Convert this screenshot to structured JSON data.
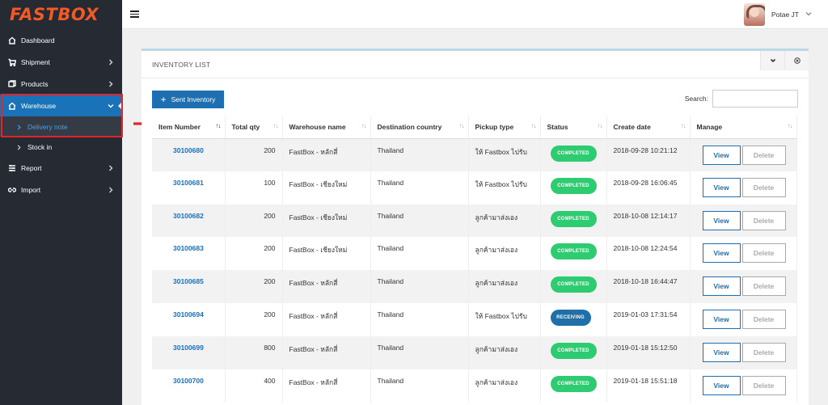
{
  "sidebar": {
    "logo": "FASTBOX",
    "items": [
      {
        "label": "Dashboard",
        "icon": "home-icon",
        "chevron": false
      },
      {
        "label": "Shipment",
        "icon": "cart-icon",
        "chevron": true
      },
      {
        "label": "Products",
        "icon": "products-icon",
        "chevron": true
      },
      {
        "label": "Warehouse",
        "icon": "home-icon",
        "chevron": true,
        "active": true
      },
      {
        "label": "Report",
        "icon": "report-icon",
        "chevron": true
      },
      {
        "label": "Import",
        "icon": "link-icon",
        "chevron": true
      }
    ],
    "sub_items": [
      {
        "label": "Delivery note",
        "active": true
      },
      {
        "label": "Stock in",
        "active": false
      }
    ]
  },
  "topbar": {
    "user_name": "Potae JT"
  },
  "panel": {
    "title": "INVENTORY LIST",
    "sent_button": "Sent Inventory",
    "search_label": "Search:",
    "search_value": ""
  },
  "table": {
    "columns": [
      "Item Number",
      "Total qty",
      "Warehouse name",
      "Destination country",
      "Pickup type",
      "Status",
      "Create date",
      "Manage"
    ],
    "view_label": "View",
    "delete_label": "Delete",
    "rows": [
      {
        "item": "30100680",
        "qty": "200",
        "warehouse": "FastBox - หลักสี่",
        "country": "Thailand",
        "pickup": "ให้ Fastbox ไปรับ",
        "status": "COMPLETED",
        "status_type": "completed",
        "date": "2018-09-28 10:21:12"
      },
      {
        "item": "30100681",
        "qty": "100",
        "warehouse": "FastBox - เชียงใหม่",
        "country": "Thailand",
        "pickup": "ให้ Fastbox ไปรับ",
        "status": "COMPLETED",
        "status_type": "completed",
        "date": "2018-09-28 16:06:45"
      },
      {
        "item": "30100682",
        "qty": "200",
        "warehouse": "FastBox - เชียงใหม่",
        "country": "Thailand",
        "pickup": "ลูกค้ามาส่งเอง",
        "status": "COMPLETED",
        "status_type": "completed",
        "date": "2018-10-08 12:14:17"
      },
      {
        "item": "30100683",
        "qty": "200",
        "warehouse": "FastBox - เชียงใหม่",
        "country": "Thailand",
        "pickup": "ลูกค้ามาส่งเอง",
        "status": "COMPLETED",
        "status_type": "completed",
        "date": "2018-10-08 12:24:54"
      },
      {
        "item": "30100685",
        "qty": "200",
        "warehouse": "FastBox - หลักสี่",
        "country": "Thailand",
        "pickup": "ลูกค้ามาส่งเอง",
        "status": "COMPLETED",
        "status_type": "completed",
        "date": "2018-10-18 16:44:47"
      },
      {
        "item": "30100694",
        "qty": "200",
        "warehouse": "FastBox - หลักสี่",
        "country": "Thailand",
        "pickup": "ให้ Fastbox ไปรับ",
        "status": "RECEIVING",
        "status_type": "receiving",
        "date": "2019-01-03 17:31:54"
      },
      {
        "item": "30100699",
        "qty": "800",
        "warehouse": "FastBox - หลักสี่",
        "country": "Thailand",
        "pickup": "ลูกค้ามาส่งเอง",
        "status": "COMPLETED",
        "status_type": "completed",
        "date": "2019-01-18 15:12:50"
      },
      {
        "item": "30100700",
        "qty": "400",
        "warehouse": "FastBox - หลักสี่",
        "country": "Thailand",
        "pickup": "ลูกค้ามาส่งเอง",
        "status": "COMPLETED",
        "status_type": "completed",
        "date": "2019-01-18 15:51:18"
      }
    ]
  },
  "colors": {
    "brand": "#f15a24",
    "sidebar_bg": "#252a33",
    "active_blue": "#1a72b8",
    "completed": "#2ecc71",
    "receiving": "#1f6fa8",
    "annotation_red": "#e0252b"
  }
}
